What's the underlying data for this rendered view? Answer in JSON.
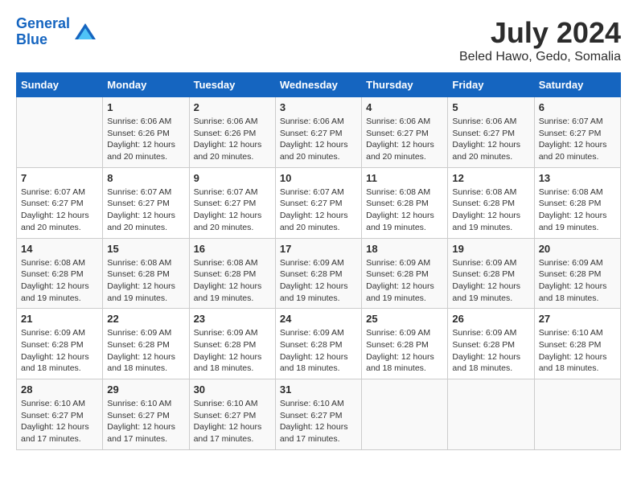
{
  "header": {
    "logo_line1": "General",
    "logo_line2": "Blue",
    "month_year": "July 2024",
    "location": "Beled Hawo, Gedo, Somalia"
  },
  "weekdays": [
    "Sunday",
    "Monday",
    "Tuesday",
    "Wednesday",
    "Thursday",
    "Friday",
    "Saturday"
  ],
  "weeks": [
    [
      {
        "day": "",
        "info": ""
      },
      {
        "day": "1",
        "info": "Sunrise: 6:06 AM\nSunset: 6:26 PM\nDaylight: 12 hours and 20 minutes."
      },
      {
        "day": "2",
        "info": "Sunrise: 6:06 AM\nSunset: 6:26 PM\nDaylight: 12 hours and 20 minutes."
      },
      {
        "day": "3",
        "info": "Sunrise: 6:06 AM\nSunset: 6:27 PM\nDaylight: 12 hours and 20 minutes."
      },
      {
        "day": "4",
        "info": "Sunrise: 6:06 AM\nSunset: 6:27 PM\nDaylight: 12 hours and 20 minutes."
      },
      {
        "day": "5",
        "info": "Sunrise: 6:06 AM\nSunset: 6:27 PM\nDaylight: 12 hours and 20 minutes."
      },
      {
        "day": "6",
        "info": "Sunrise: 6:07 AM\nSunset: 6:27 PM\nDaylight: 12 hours and 20 minutes."
      }
    ],
    [
      {
        "day": "7",
        "info": "Sunrise: 6:07 AM\nSunset: 6:27 PM\nDaylight: 12 hours and 20 minutes."
      },
      {
        "day": "8",
        "info": "Sunrise: 6:07 AM\nSunset: 6:27 PM\nDaylight: 12 hours and 20 minutes."
      },
      {
        "day": "9",
        "info": "Sunrise: 6:07 AM\nSunset: 6:27 PM\nDaylight: 12 hours and 20 minutes."
      },
      {
        "day": "10",
        "info": "Sunrise: 6:07 AM\nSunset: 6:27 PM\nDaylight: 12 hours and 20 minutes."
      },
      {
        "day": "11",
        "info": "Sunrise: 6:08 AM\nSunset: 6:28 PM\nDaylight: 12 hours and 19 minutes."
      },
      {
        "day": "12",
        "info": "Sunrise: 6:08 AM\nSunset: 6:28 PM\nDaylight: 12 hours and 19 minutes."
      },
      {
        "day": "13",
        "info": "Sunrise: 6:08 AM\nSunset: 6:28 PM\nDaylight: 12 hours and 19 minutes."
      }
    ],
    [
      {
        "day": "14",
        "info": "Sunrise: 6:08 AM\nSunset: 6:28 PM\nDaylight: 12 hours and 19 minutes."
      },
      {
        "day": "15",
        "info": "Sunrise: 6:08 AM\nSunset: 6:28 PM\nDaylight: 12 hours and 19 minutes."
      },
      {
        "day": "16",
        "info": "Sunrise: 6:08 AM\nSunset: 6:28 PM\nDaylight: 12 hours and 19 minutes."
      },
      {
        "day": "17",
        "info": "Sunrise: 6:09 AM\nSunset: 6:28 PM\nDaylight: 12 hours and 19 minutes."
      },
      {
        "day": "18",
        "info": "Sunrise: 6:09 AM\nSunset: 6:28 PM\nDaylight: 12 hours and 19 minutes."
      },
      {
        "day": "19",
        "info": "Sunrise: 6:09 AM\nSunset: 6:28 PM\nDaylight: 12 hours and 19 minutes."
      },
      {
        "day": "20",
        "info": "Sunrise: 6:09 AM\nSunset: 6:28 PM\nDaylight: 12 hours and 18 minutes."
      }
    ],
    [
      {
        "day": "21",
        "info": "Sunrise: 6:09 AM\nSunset: 6:28 PM\nDaylight: 12 hours and 18 minutes."
      },
      {
        "day": "22",
        "info": "Sunrise: 6:09 AM\nSunset: 6:28 PM\nDaylight: 12 hours and 18 minutes."
      },
      {
        "day": "23",
        "info": "Sunrise: 6:09 AM\nSunset: 6:28 PM\nDaylight: 12 hours and 18 minutes."
      },
      {
        "day": "24",
        "info": "Sunrise: 6:09 AM\nSunset: 6:28 PM\nDaylight: 12 hours and 18 minutes."
      },
      {
        "day": "25",
        "info": "Sunrise: 6:09 AM\nSunset: 6:28 PM\nDaylight: 12 hours and 18 minutes."
      },
      {
        "day": "26",
        "info": "Sunrise: 6:09 AM\nSunset: 6:28 PM\nDaylight: 12 hours and 18 minutes."
      },
      {
        "day": "27",
        "info": "Sunrise: 6:10 AM\nSunset: 6:28 PM\nDaylight: 12 hours and 18 minutes."
      }
    ],
    [
      {
        "day": "28",
        "info": "Sunrise: 6:10 AM\nSunset: 6:27 PM\nDaylight: 12 hours and 17 minutes."
      },
      {
        "day": "29",
        "info": "Sunrise: 6:10 AM\nSunset: 6:27 PM\nDaylight: 12 hours and 17 minutes."
      },
      {
        "day": "30",
        "info": "Sunrise: 6:10 AM\nSunset: 6:27 PM\nDaylight: 12 hours and 17 minutes."
      },
      {
        "day": "31",
        "info": "Sunrise: 6:10 AM\nSunset: 6:27 PM\nDaylight: 12 hours and 17 minutes."
      },
      {
        "day": "",
        "info": ""
      },
      {
        "day": "",
        "info": ""
      },
      {
        "day": "",
        "info": ""
      }
    ]
  ]
}
